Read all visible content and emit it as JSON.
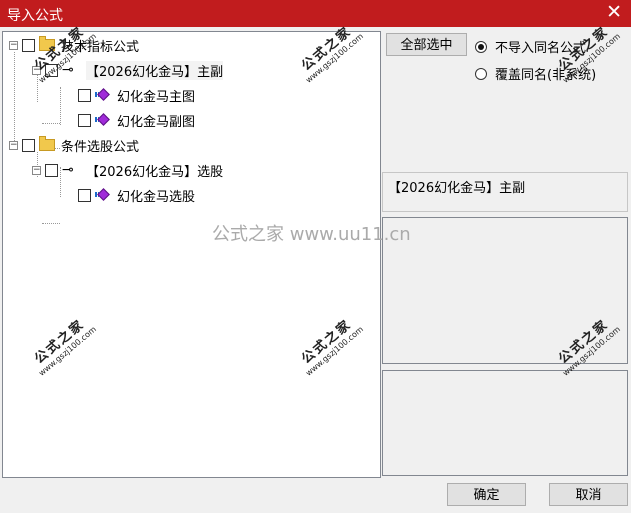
{
  "window": {
    "title": "导入公式",
    "close_symbol": "✕"
  },
  "tree": {
    "nodes": [
      {
        "label": "技术指标公式",
        "type": "folder",
        "expander": "−"
      },
      {
        "label": "【2026幻化金马】主副",
        "type": "formula-key",
        "expander": "−"
      },
      {
        "label": "幻化金马主图",
        "type": "formula"
      },
      {
        "label": "幻化金马副图",
        "type": "formula"
      },
      {
        "label": "条件选股公式",
        "type": "folder",
        "expander": "−"
      },
      {
        "label": "【2026幻化金马】选股",
        "type": "formula-key",
        "expander": "−"
      },
      {
        "label": "幻化金马选股",
        "type": "formula"
      }
    ],
    "key_symbol": "⊸"
  },
  "options": {
    "select_all_label": "全部选中",
    "radio_no_import_label": "不导入同名公式",
    "radio_overwrite_label": "覆盖同名(非系统)",
    "selected_radio": "no_import"
  },
  "info": {
    "selected_formula_name": "【2026幻化金马】主副"
  },
  "footer": {
    "ok_label": "确定",
    "cancel_label": "取消"
  },
  "watermark": {
    "main": "公式之家",
    "url": "www.gszj100.com",
    "center": "公式之家 www.uu11.cn"
  }
}
